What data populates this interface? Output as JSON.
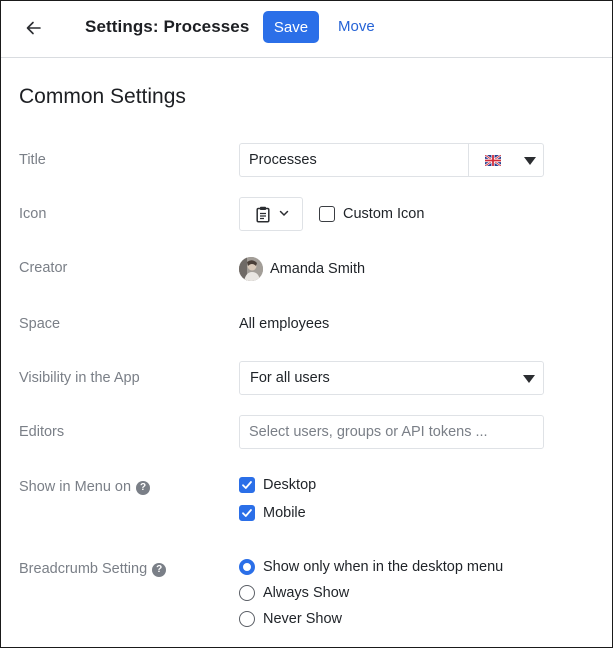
{
  "header": {
    "back_icon": "arrow-left-icon",
    "title": "Settings: Processes",
    "save_label": "Save",
    "move_label": "Move"
  },
  "section": {
    "title": "Common Settings"
  },
  "fields": {
    "title": {
      "label": "Title",
      "value": "Processes",
      "language_icon": "uk-flag-icon"
    },
    "icon": {
      "label": "Icon",
      "selected_icon": "clipboard-icon",
      "custom_label": "Custom Icon",
      "custom_checked": false
    },
    "creator": {
      "label": "Creator",
      "name": "Amanda Smith"
    },
    "space": {
      "label": "Space",
      "value": "All employees"
    },
    "visibility": {
      "label": "Visibility in the App",
      "value": "For all users"
    },
    "editors": {
      "label": "Editors",
      "placeholder": "Select users, groups or API tokens ..."
    },
    "menu": {
      "label": "Show in Menu on",
      "options": [
        {
          "label": "Desktop",
          "checked": true
        },
        {
          "label": "Mobile",
          "checked": true
        }
      ]
    },
    "breadcrumb": {
      "label": "Breadcrumb Setting",
      "options": [
        {
          "label": "Show only when in the desktop menu",
          "selected": true
        },
        {
          "label": "Always Show",
          "selected": false
        },
        {
          "label": "Never Show",
          "selected": false
        }
      ]
    }
  },
  "colors": {
    "primary": "#2b6fe8",
    "link": "#2563d6",
    "label": "#7a7f87"
  }
}
